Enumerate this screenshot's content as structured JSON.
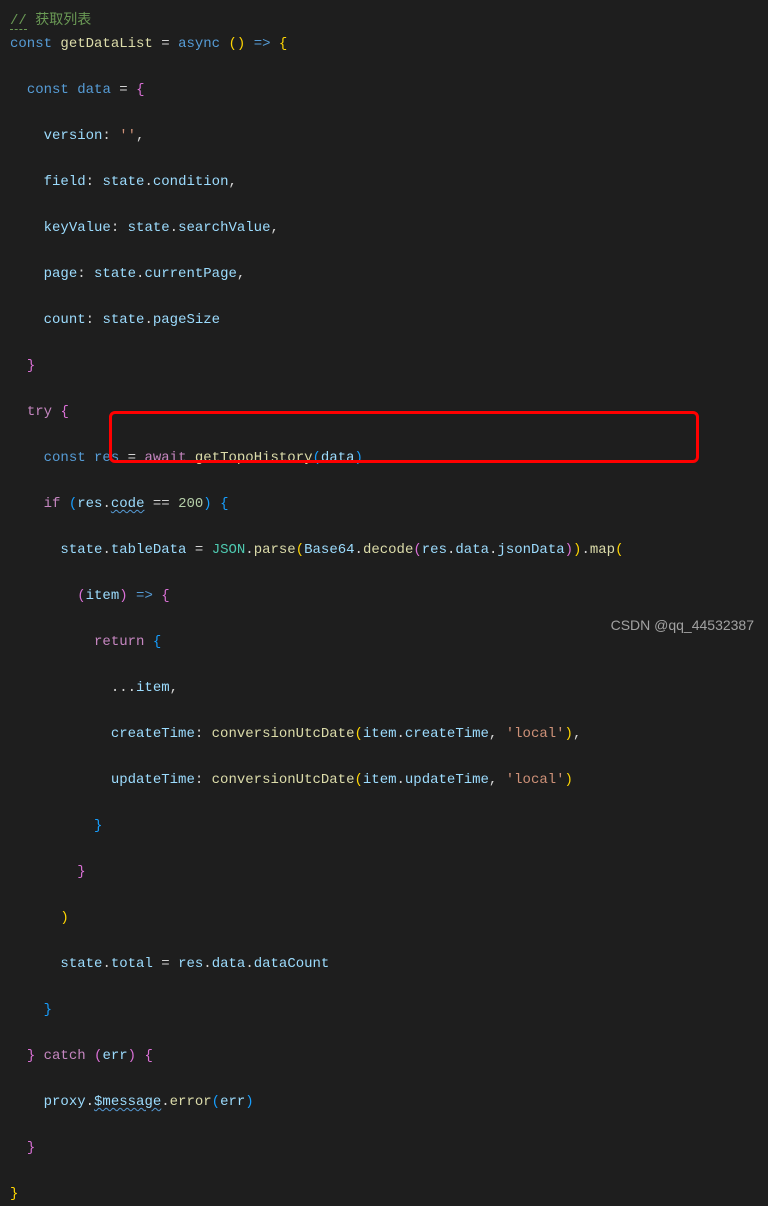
{
  "code": {
    "l01_a": "//",
    "l01_b": " 获取列表",
    "l02_a": "const",
    "l02_b": " ",
    "l02_c": "getDataList",
    "l02_d": " = ",
    "l02_e": "async",
    "l02_f": " ",
    "l02_g": "(",
    "l02_h": ")",
    "l02_i": " ",
    "l02_j": "=>",
    "l02_k": " ",
    "l02_l": "{",
    "l03_a": "  ",
    "l03_b": "const",
    "l03_c": " ",
    "l03_d": "data",
    "l03_e": " = ",
    "l03_f": "{",
    "l04_a": "    ",
    "l04_b": "version",
    "l04_c": ": ",
    "l04_d": "''",
    "l04_e": ",",
    "l05_a": "    ",
    "l05_b": "field",
    "l05_c": ": ",
    "l05_d": "state",
    "l05_e": ".",
    "l05_f": "condition",
    "l05_g": ",",
    "l06_a": "    ",
    "l06_b": "keyValue",
    "l06_c": ": ",
    "l06_d": "state",
    "l06_e": ".",
    "l06_f": "searchValue",
    "l06_g": ",",
    "l07_a": "    ",
    "l07_b": "page",
    "l07_c": ": ",
    "l07_d": "state",
    "l07_e": ".",
    "l07_f": "currentPage",
    "l07_g": ",",
    "l08_a": "    ",
    "l08_b": "count",
    "l08_c": ": ",
    "l08_d": "state",
    "l08_e": ".",
    "l08_f": "pageSize",
    "l09_a": "  ",
    "l09_b": "}",
    "l10_a": "  ",
    "l10_b": "try",
    "l10_c": " ",
    "l10_d": "{",
    "l11_a": "    ",
    "l11_b": "const",
    "l11_c": " ",
    "l11_d": "res",
    "l11_e": " = ",
    "l11_f": "await",
    "l11_g": " ",
    "l11_h": "getTopoHistory",
    "l11_i": "(",
    "l11_j": "data",
    "l11_k": ")",
    "l12_a": "    ",
    "l12_b": "if",
    "l12_c": " ",
    "l12_d": "(",
    "l12_e": "res",
    "l12_f": ".",
    "l12_g": "code",
    "l12_h": " == ",
    "l12_i": "200",
    "l12_j": ")",
    "l12_k": " ",
    "l12_l": "{",
    "l13_a": "      ",
    "l13_b": "state",
    "l13_c": ".",
    "l13_d": "tableData",
    "l13_e": " = ",
    "l13_f": "JSON",
    "l13_g": ".",
    "l13_h": "parse",
    "l13_i": "(",
    "l13_j": "Base64",
    "l13_k": ".",
    "l13_l": "decode",
    "l13_m": "(",
    "l13_n": "res",
    "l13_o": ".",
    "l13_p": "data",
    "l13_q": ".",
    "l13_r": "jsonData",
    "l13_s": ")",
    "l13_t": ")",
    "l13_u": ".",
    "l13_v": "map",
    "l13_w": "(",
    "l14_a": "        ",
    "l14_b": "(",
    "l14_c": "item",
    "l14_d": ")",
    "l14_e": " ",
    "l14_f": "=>",
    "l14_g": " ",
    "l14_h": "{",
    "l15_a": "          ",
    "l15_b": "return",
    "l15_c": " ",
    "l15_d": "{",
    "l16_a": "            ...",
    "l16_b": "item",
    "l16_c": ",",
    "l17_a": "            ",
    "l17_b": "createTime",
    "l17_c": ": ",
    "l17_d": "conversionUtcDate",
    "l17_e": "(",
    "l17_f": "item",
    "l17_g": ".",
    "l17_h": "createTime",
    "l17_i": ", ",
    "l17_j": "'local'",
    "l17_k": ")",
    "l17_l": ",",
    "l18_a": "            ",
    "l18_b": "updateTime",
    "l18_c": ": ",
    "l18_d": "conversionUtcDate",
    "l18_e": "(",
    "l18_f": "item",
    "l18_g": ".",
    "l18_h": "updateTime",
    "l18_i": ", ",
    "l18_j": "'local'",
    "l18_k": ")",
    "l19_a": "          ",
    "l19_b": "}",
    "l20_a": "        ",
    "l20_b": "}",
    "l21_a": "      ",
    "l21_b": ")",
    "l22_a": "      ",
    "l22_b": "state",
    "l22_c": ".",
    "l22_d": "total",
    "l22_e": " = ",
    "l22_f": "res",
    "l22_g": ".",
    "l22_h": "data",
    "l22_i": ".",
    "l22_j": "dataCount",
    "l23_a": "    ",
    "l23_b": "}",
    "l24_a": "  ",
    "l24_b": "}",
    "l24_c": " ",
    "l24_d": "catch",
    "l24_e": " ",
    "l24_f": "(",
    "l24_g": "err",
    "l24_h": ")",
    "l24_i": " ",
    "l24_j": "{",
    "l25_a": "    ",
    "l25_b": "proxy",
    "l25_c": ".",
    "l25_d": "$message",
    "l25_e": ".",
    "l25_f": "error",
    "l25_g": "(",
    "l25_h": "err",
    "l25_i": ")",
    "l26_a": "  ",
    "l26_b": "}",
    "l27_a": "}"
  },
  "watermark": "CSDN @qq_44532387"
}
